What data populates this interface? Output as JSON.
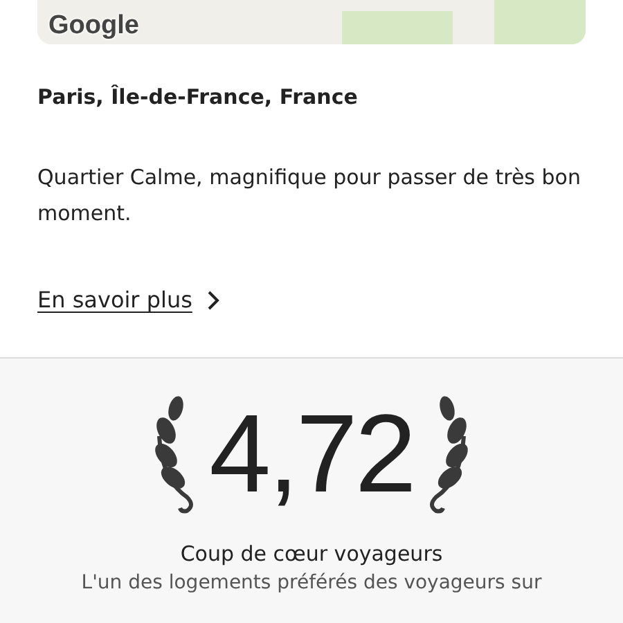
{
  "map": {
    "logo": "Google"
  },
  "location": "Paris, Île-de-France, France",
  "description": "Quartier Calme, magnifique pour passer de très bon moment.",
  "link": {
    "label": "En savoir plus"
  },
  "rating": {
    "value": "4,72",
    "title": "Coup de cœur voyageurs",
    "subtitle": "L'un des logements préférés des voyageurs sur"
  }
}
